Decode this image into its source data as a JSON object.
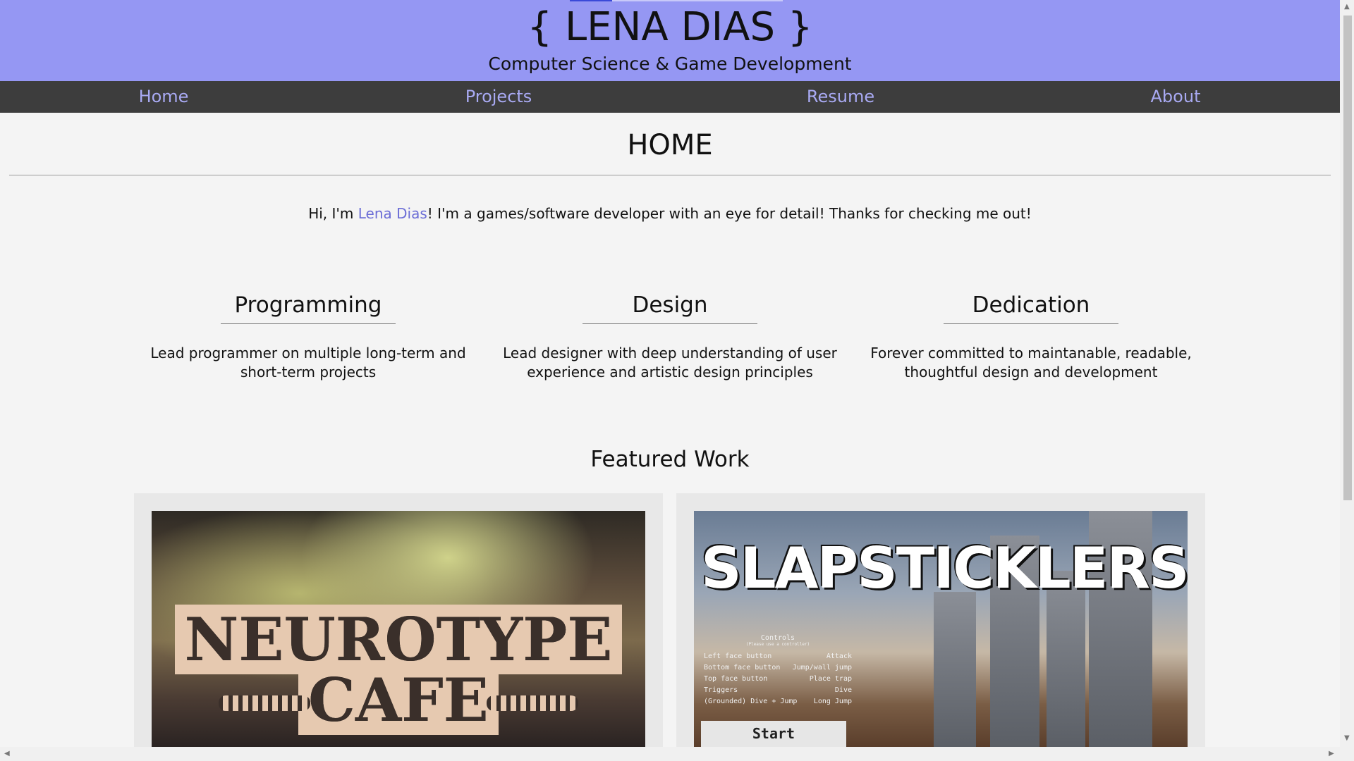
{
  "header": {
    "title": "{ LENA DIAS }",
    "subtitle": "Computer Science & Game Development"
  },
  "nav": {
    "items": [
      "Home",
      "Projects",
      "Resume",
      "About"
    ]
  },
  "main": {
    "heading": "HOME",
    "intro_before": "Hi, I'm ",
    "intro_link": "Lena Dias",
    "intro_after": "! I'm a games/software developer with an eye for detail! Thanks for checking me out!"
  },
  "features": [
    {
      "title": "Programming",
      "text": "Lead programmer on multiple long-term and short-term projects"
    },
    {
      "title": "Design",
      "text": "Lead designer with deep understanding of user experience and artistic design principles"
    },
    {
      "title": "Dedication",
      "text": "Forever committed to maintanable, readable, thoughtful design and development"
    }
  ],
  "featured": {
    "heading": "Featured Work",
    "cards": [
      {
        "title_line1": "NEUROTYPE",
        "title_line2": "CAFE"
      },
      {
        "title": "SLAPSTICKLERS",
        "controls_title": "Controls",
        "controls_subtitle": "(Please use a controller)",
        "controls": [
          [
            "Left face button",
            "Attack"
          ],
          [
            "Bottom face button",
            "Jump/wall jump"
          ],
          [
            "Top face button",
            "Place trap"
          ],
          [
            "Triggers",
            "Dive"
          ],
          [
            "(Grounded) Dive + Jump",
            "Long Jump"
          ]
        ],
        "start_label": "Start"
      }
    ]
  },
  "colors": {
    "banner": "#9597f3",
    "navbar": "#3d3d3d",
    "link": "#a9aaf3",
    "background": "#f4f4f4"
  }
}
